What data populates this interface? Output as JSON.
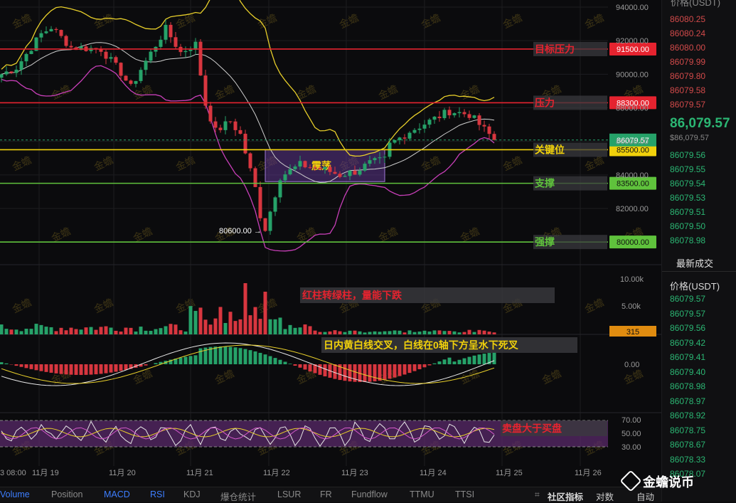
{
  "chart_data": {
    "type": "candlestick",
    "price_axis": {
      "ticks": [
        94000,
        92000,
        90000,
        88000,
        86000,
        84000,
        82000
      ],
      "tick_labels": [
        "94000.00",
        "92000.00",
        "90000.00",
        "88000.00",
        "86000.00",
        "84000.00",
        "82000.00"
      ]
    },
    "x_axis_labels": [
      "3 08:00",
      "11月 19",
      "11月 20",
      "11月 21",
      "11月 22",
      "11月 23",
      "11月 24",
      "11月 25",
      "11月 26"
    ],
    "last_price": {
      "value": 86079.57,
      "label": "86079.57",
      "color": "#26a269"
    },
    "price_lines": [
      {
        "price": 91500,
        "label": "91500.00",
        "note": "目标压力",
        "color": "#e5232f"
      },
      {
        "price": 88300,
        "label": "88300.00",
        "note": "压力",
        "color": "#e5232f"
      },
      {
        "price": 85500,
        "label": "85500.00",
        "note": "关键位",
        "color": "#f1d10b"
      },
      {
        "price": 83500,
        "label": "83500.00",
        "note": "支撑",
        "color": "#5fc23c"
      },
      {
        "price": 80000,
        "label": "80000.00",
        "note": "强撑",
        "color": "#5fc23c"
      }
    ],
    "consolidation_box": {
      "label": "震荡",
      "price_high": 85500,
      "price_low": 83600,
      "color": "#6c3fa6"
    },
    "low_marker": {
      "price": 80600,
      "label": "80600.00 →"
    },
    "volume": {
      "tick_labels": [
        "10.00k",
        "5.00k"
      ],
      "last_value_label": "315",
      "note": "红柱转绿柱，量能下跌"
    },
    "macd": {
      "tick_labels": [
        "0.00"
      ],
      "note": "日内黄白线交叉，白线在0轴下方呈水下死叉"
    },
    "rsi": {
      "tick_labels": [
        "70.00",
        "50.00",
        "30.00"
      ],
      "note": "卖盘大于买盘"
    },
    "watermark": "金蟾",
    "series_colors": {
      "up": "#26a269",
      "down": "#d8363f",
      "upper_band": "#e8cf2a",
      "middle_band": "#cfcfcf",
      "lower_band": "#c83fb8"
    }
  },
  "right_panel": {
    "header": "价格(USDT)",
    "asks": [
      "86080.25",
      "86080.24",
      "86080.00",
      "86079.99",
      "86079.80",
      "86079.58",
      "86079.57"
    ],
    "last_big": "86,079.57",
    "last_small": "$86,079.57",
    "bids": [
      "86079.56",
      "86079.55",
      "86079.54",
      "86079.53",
      "86079.51",
      "86079.50",
      "86078.98"
    ],
    "trades_title": "最新成交",
    "trades_header": "价格(USDT)",
    "trades": [
      "86079.57",
      "86079.57",
      "86079.56",
      "86079.42",
      "86079.41",
      "86079.40",
      "86078.98",
      "86078.97",
      "86078.92",
      "86078.75",
      "86078.67",
      "86078.33",
      "86078.07"
    ]
  },
  "bottom_tabs": [
    "Volume",
    "Position",
    "MACD",
    "RSI",
    "KDJ",
    "爆仓统计",
    "LSUR",
    "FR",
    "Fundflow",
    "TTMU",
    "TTSI"
  ],
  "bottom_right": {
    "community": "社区指标",
    "compare": "对数",
    "auto": "自动"
  },
  "brand": "金蟾说币"
}
